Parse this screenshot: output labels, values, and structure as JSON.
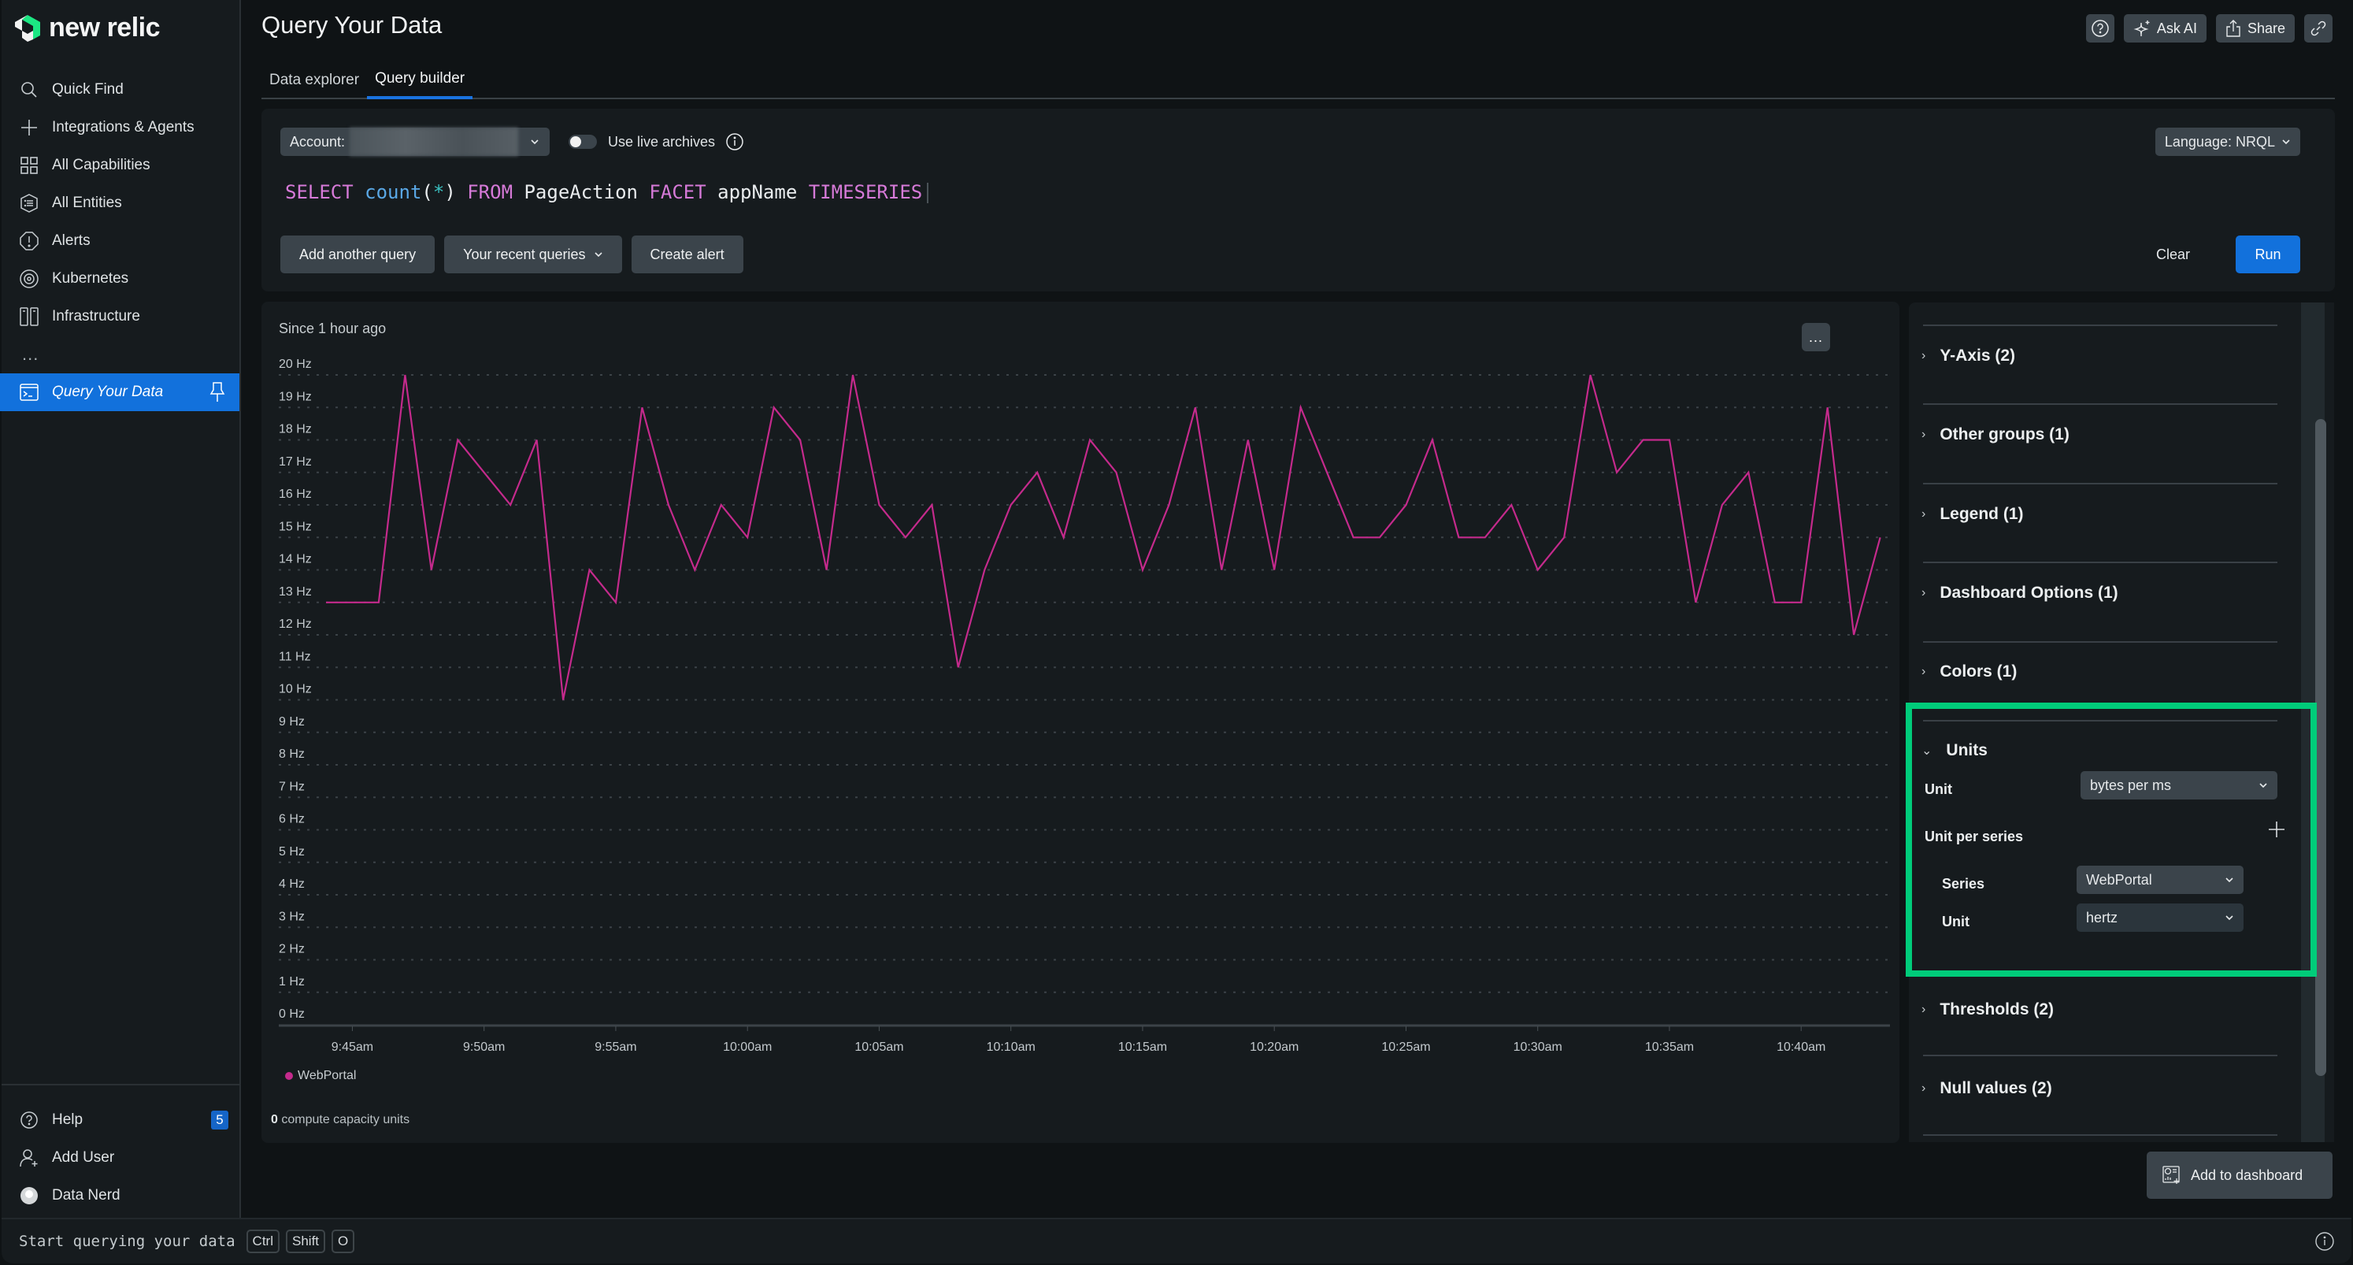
{
  "app": {
    "brand": "new relic",
    "page_title": "Query Your Data",
    "brand_color": "#1ce783",
    "accent_color": "#1271dc"
  },
  "sidebar": {
    "items": [
      {
        "label": "Quick Find",
        "icon": "search-icon"
      },
      {
        "label": "Integrations & Agents",
        "icon": "plus-icon"
      },
      {
        "label": "All Capabilities",
        "icon": "grid-icon"
      },
      {
        "label": "All Entities",
        "icon": "entities-icon"
      },
      {
        "label": "Alerts",
        "icon": "alert-icon"
      },
      {
        "label": "Kubernetes",
        "icon": "kubernetes-icon"
      },
      {
        "label": "Infrastructure",
        "icon": "infrastructure-icon"
      }
    ],
    "more_label": "...",
    "active_item": {
      "label": "Query Your Data",
      "icon": "terminal-icon",
      "pin_icon": "pin-icon"
    },
    "bottom_items": [
      {
        "label": "Help",
        "icon": "help-icon",
        "badge": "5"
      },
      {
        "label": "Add User",
        "icon": "add-user-icon"
      },
      {
        "label": "Data Nerd",
        "icon": "avatar"
      }
    ]
  },
  "header": {
    "actions": {
      "help_icon": "help-icon",
      "ask_ai": "Ask AI",
      "share": "Share",
      "link_icon": "link-icon"
    },
    "tabs": [
      {
        "label": "Data explorer",
        "active": false
      },
      {
        "label": "Query builder",
        "active": true
      }
    ]
  },
  "query": {
    "account_label": "Account:",
    "account_value_redacted": true,
    "live_archives_label": "Use live archives",
    "live_archives_enabled": false,
    "language_label": "Language: NRQL",
    "nrql": {
      "select": "SELECT",
      "func": "count",
      "open": "(",
      "star": "*",
      "close": ")",
      "from": "FROM",
      "event": "PageAction",
      "facet": "FACET",
      "attr": "appName",
      "timeseries": "TIMESERIES"
    },
    "buttons": {
      "add_query": "Add another query",
      "recent": "Your recent queries",
      "create_alert": "Create alert",
      "clear": "Clear",
      "run": "Run"
    }
  },
  "chart_panel": {
    "since": "Since 1 hour ago",
    "more_label": "...",
    "compute_value": "0",
    "compute_label": "compute capacity units"
  },
  "chart_data": {
    "type": "line",
    "title": "",
    "subtitle": "Since 1 hour ago",
    "xlabel": "",
    "ylabel": "",
    "y_unit": "Hz",
    "ylim": [
      0,
      20
    ],
    "yticks": [
      "0 Hz",
      "1 Hz",
      "2 Hz",
      "3 Hz",
      "4 Hz",
      "5 Hz",
      "6 Hz",
      "7 Hz",
      "8 Hz",
      "9 Hz",
      "10 Hz",
      "11 Hz",
      "12 Hz",
      "13 Hz",
      "14 Hz",
      "15 Hz",
      "16 Hz",
      "17 Hz",
      "18 Hz",
      "19 Hz",
      "20 Hz"
    ],
    "x_start_label": "9:44am",
    "x_interval_minutes": 1,
    "xticks": [
      {
        "label": "9:45am",
        "index": 1
      },
      {
        "label": "9:50am",
        "index": 6
      },
      {
        "label": "9:55am",
        "index": 11
      },
      {
        "label": "10:00am",
        "index": 16
      },
      {
        "label": "10:05am",
        "index": 21
      },
      {
        "label": "10:10am",
        "index": 26
      },
      {
        "label": "10:15am",
        "index": 31
      },
      {
        "label": "10:20am",
        "index": 36
      },
      {
        "label": "10:25am",
        "index": 41
      },
      {
        "label": "10:30am",
        "index": 46
      },
      {
        "label": "10:35am",
        "index": 51
      },
      {
        "label": "10:40am",
        "index": 56
      }
    ],
    "grid": true,
    "legend_position": "bottom-left",
    "series": [
      {
        "name": "WebPortal",
        "color": "#c42a8c",
        "values": [
          13,
          13,
          13,
          20,
          14,
          18,
          17,
          16,
          18,
          10,
          14,
          13,
          19,
          16,
          14,
          16,
          15,
          19,
          18,
          14,
          20,
          16,
          15,
          16,
          11,
          14,
          16,
          17,
          15,
          18,
          17,
          14,
          16,
          19,
          14,
          18,
          14,
          19,
          17,
          15,
          15,
          16,
          18,
          15,
          15,
          16,
          14,
          15,
          20,
          17,
          18,
          18,
          13,
          16,
          17,
          13,
          13,
          19,
          12,
          15
        ]
      }
    ]
  },
  "settings": {
    "sections_above": [
      {
        "label": "Y-Axis (2)"
      },
      {
        "label": "Other groups (1)"
      },
      {
        "label": "Legend (1)"
      },
      {
        "label": "Dashboard Options (1)"
      },
      {
        "label": "Colors (1)"
      }
    ],
    "units": {
      "title": "Units",
      "unit_label": "Unit",
      "unit_value": "bytes per ms",
      "per_series_label": "Unit per series",
      "series_label": "Series",
      "series_value": "WebPortal",
      "series_unit_label": "Unit",
      "series_unit_value": "hertz",
      "highlight_color": "#00cc7a"
    },
    "sections_below": [
      {
        "label": "Thresholds (2)"
      },
      {
        "label": "Null values (2)"
      }
    ],
    "add_to_dashboard": "Add to dashboard"
  },
  "footer": {
    "hint": "Start querying your data",
    "keys": [
      "Ctrl",
      "Shift",
      "O"
    ]
  }
}
